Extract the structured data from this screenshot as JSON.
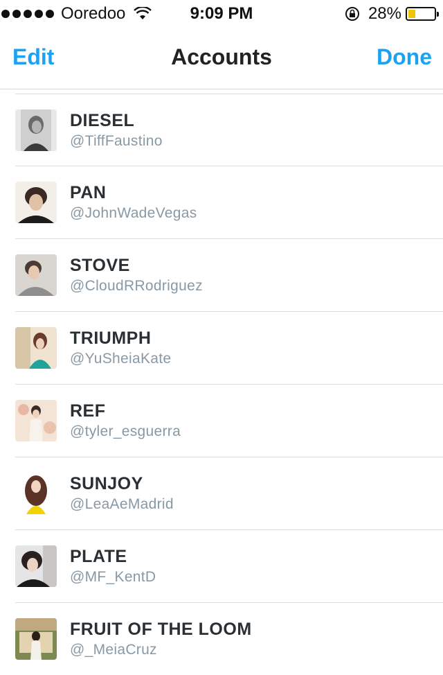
{
  "status_bar": {
    "carrier": "Ooredoo",
    "time": "9:09 PM",
    "battery_percent": "28%",
    "battery_level": 0.28,
    "battery_color": "#f2c500"
  },
  "nav": {
    "left_label": "Edit",
    "title": "Accounts",
    "right_label": "Done",
    "accent_color": "#1da1f2"
  },
  "accounts": [
    {
      "name": "DIESEL",
      "handle": "@TiffFaustino"
    },
    {
      "name": "PAN",
      "handle": "@JohnWadeVegas"
    },
    {
      "name": "STOVE",
      "handle": "@CloudRRodriguez"
    },
    {
      "name": "TRIUMPH",
      "handle": "@YuSheiaKate"
    },
    {
      "name": "REF",
      "handle": "@tyler_esguerra"
    },
    {
      "name": "SUNJOY",
      "handle": "@LeaAeMadrid"
    },
    {
      "name": "PLATE",
      "handle": "@MF_KentD"
    },
    {
      "name": "FRUIT OF THE LOOM",
      "handle": "@_MeiaCruz"
    }
  ]
}
